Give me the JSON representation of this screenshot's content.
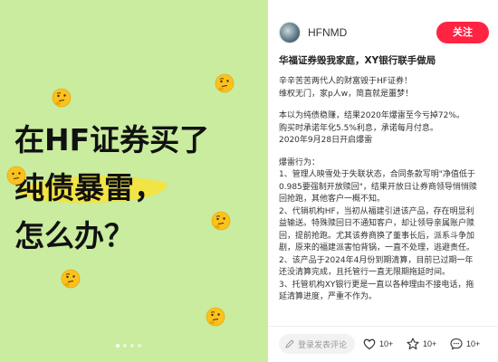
{
  "image": {
    "headline_lines": [
      "在HF证券买了",
      "纯债暴雷，",
      "怎么办？"
    ],
    "background_color": "#c9ec9e",
    "highlight_color": "#f5e33a",
    "decorations": [
      "thinking-face-emoji"
    ],
    "carousel": {
      "total": 4,
      "active_index": 0
    }
  },
  "author": {
    "name": "HFNMD",
    "follow_label": "关注"
  },
  "post": {
    "title": "华福证券毁我家庭，XY银行联手做局",
    "intro_lines": [
      "辛辛苦苦两代人的财富毁于HF证券！",
      "维权无门，家p人w，简直就是噩梦！"
    ],
    "product_lines": [
      "本以为纯债稳赚，结果2020年爆雷至今亏掉72%。",
      "购买时承诺年化5.5%利息，承诺每月付息。",
      "2020年9月28日开启爆雷"
    ],
    "actions_heading": "爆雷行为：",
    "action_lines": [
      "1、管理人映雪处于失联状态，合同条款写明\"净值低于",
      "0.985要强制开放赎回\"，结果开放日让券商领导悄悄赎",
      "回抢跑，其他客户一概不知。",
      "2、代销机构HF，当初从福建引进该产品，存在明显利",
      "益输送。特殊赎回日不通知客户，却让领导亲属账户赎",
      "回，提前抢跑。尤其该券商换了董事长后，派系斗争加",
      "剧，原来的福建派害怕背锅，一直不处理，逃避责任。",
      "2、该产品于2024年4月份到期清算，目前已过期一年",
      "还没清算完成，且托管行一直无限期拖延时间。",
      "3、托管机构XY银行更是一直以各种理由不接电话，拖",
      "延清算进度，严重不作为。"
    ]
  },
  "bottom_bar": {
    "comment_placeholder": "登录发表评论",
    "like_count": "10+",
    "star_count": "10+",
    "comment_count": "10+"
  },
  "colors": {
    "accent": "#ff2442",
    "text": "#333333",
    "muted": "#999999"
  },
  "icons": [
    "pencil-icon",
    "heart-icon",
    "star-icon",
    "comment-bubble-icon"
  ]
}
